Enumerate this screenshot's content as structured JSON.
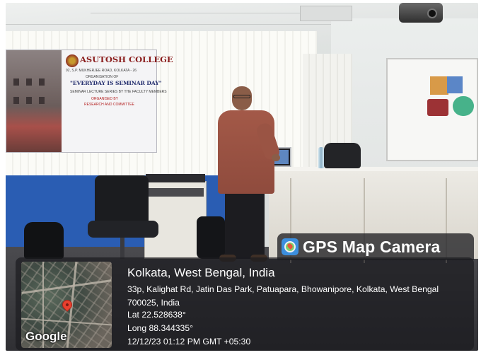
{
  "banner": {
    "title": "ASUTOSH COLLEGE",
    "address": "92, S.P. MUKHERJEE ROAD, KOLKATA - 26",
    "organising": "ORGANISATION OF",
    "tagline": "\"EVERYDAY IS SEMINAR DAY\"",
    "series": "SEMINAR LECTURE SERIES BY THE FACULTY MEMBERS",
    "organised_by": "ORGANISED BY",
    "committee": "RESEARCH AND COMMITTEE"
  },
  "overlay": {
    "app_title": "GPS Map Camera",
    "city": "Kolkata, West Bengal, India",
    "address": "33p, Kalighat Rd, Jatin Das Park, Patuapara, Bhowanipore, Kolkata, West Bengal 700025, India",
    "lat": "Lat 22.528638°",
    "long": "Long 88.344335°",
    "datetime": "12/12/23 01:12 PM GMT +05:30",
    "map_logo": "Google"
  },
  "icons": {
    "app_icon": "gps-map-camera-icon",
    "map_marker": "map-pin-icon"
  },
  "colors": {
    "wall_blue": "#2a5db3",
    "banner_red": "#8a1c1c",
    "map_pin": "#e8402f"
  }
}
